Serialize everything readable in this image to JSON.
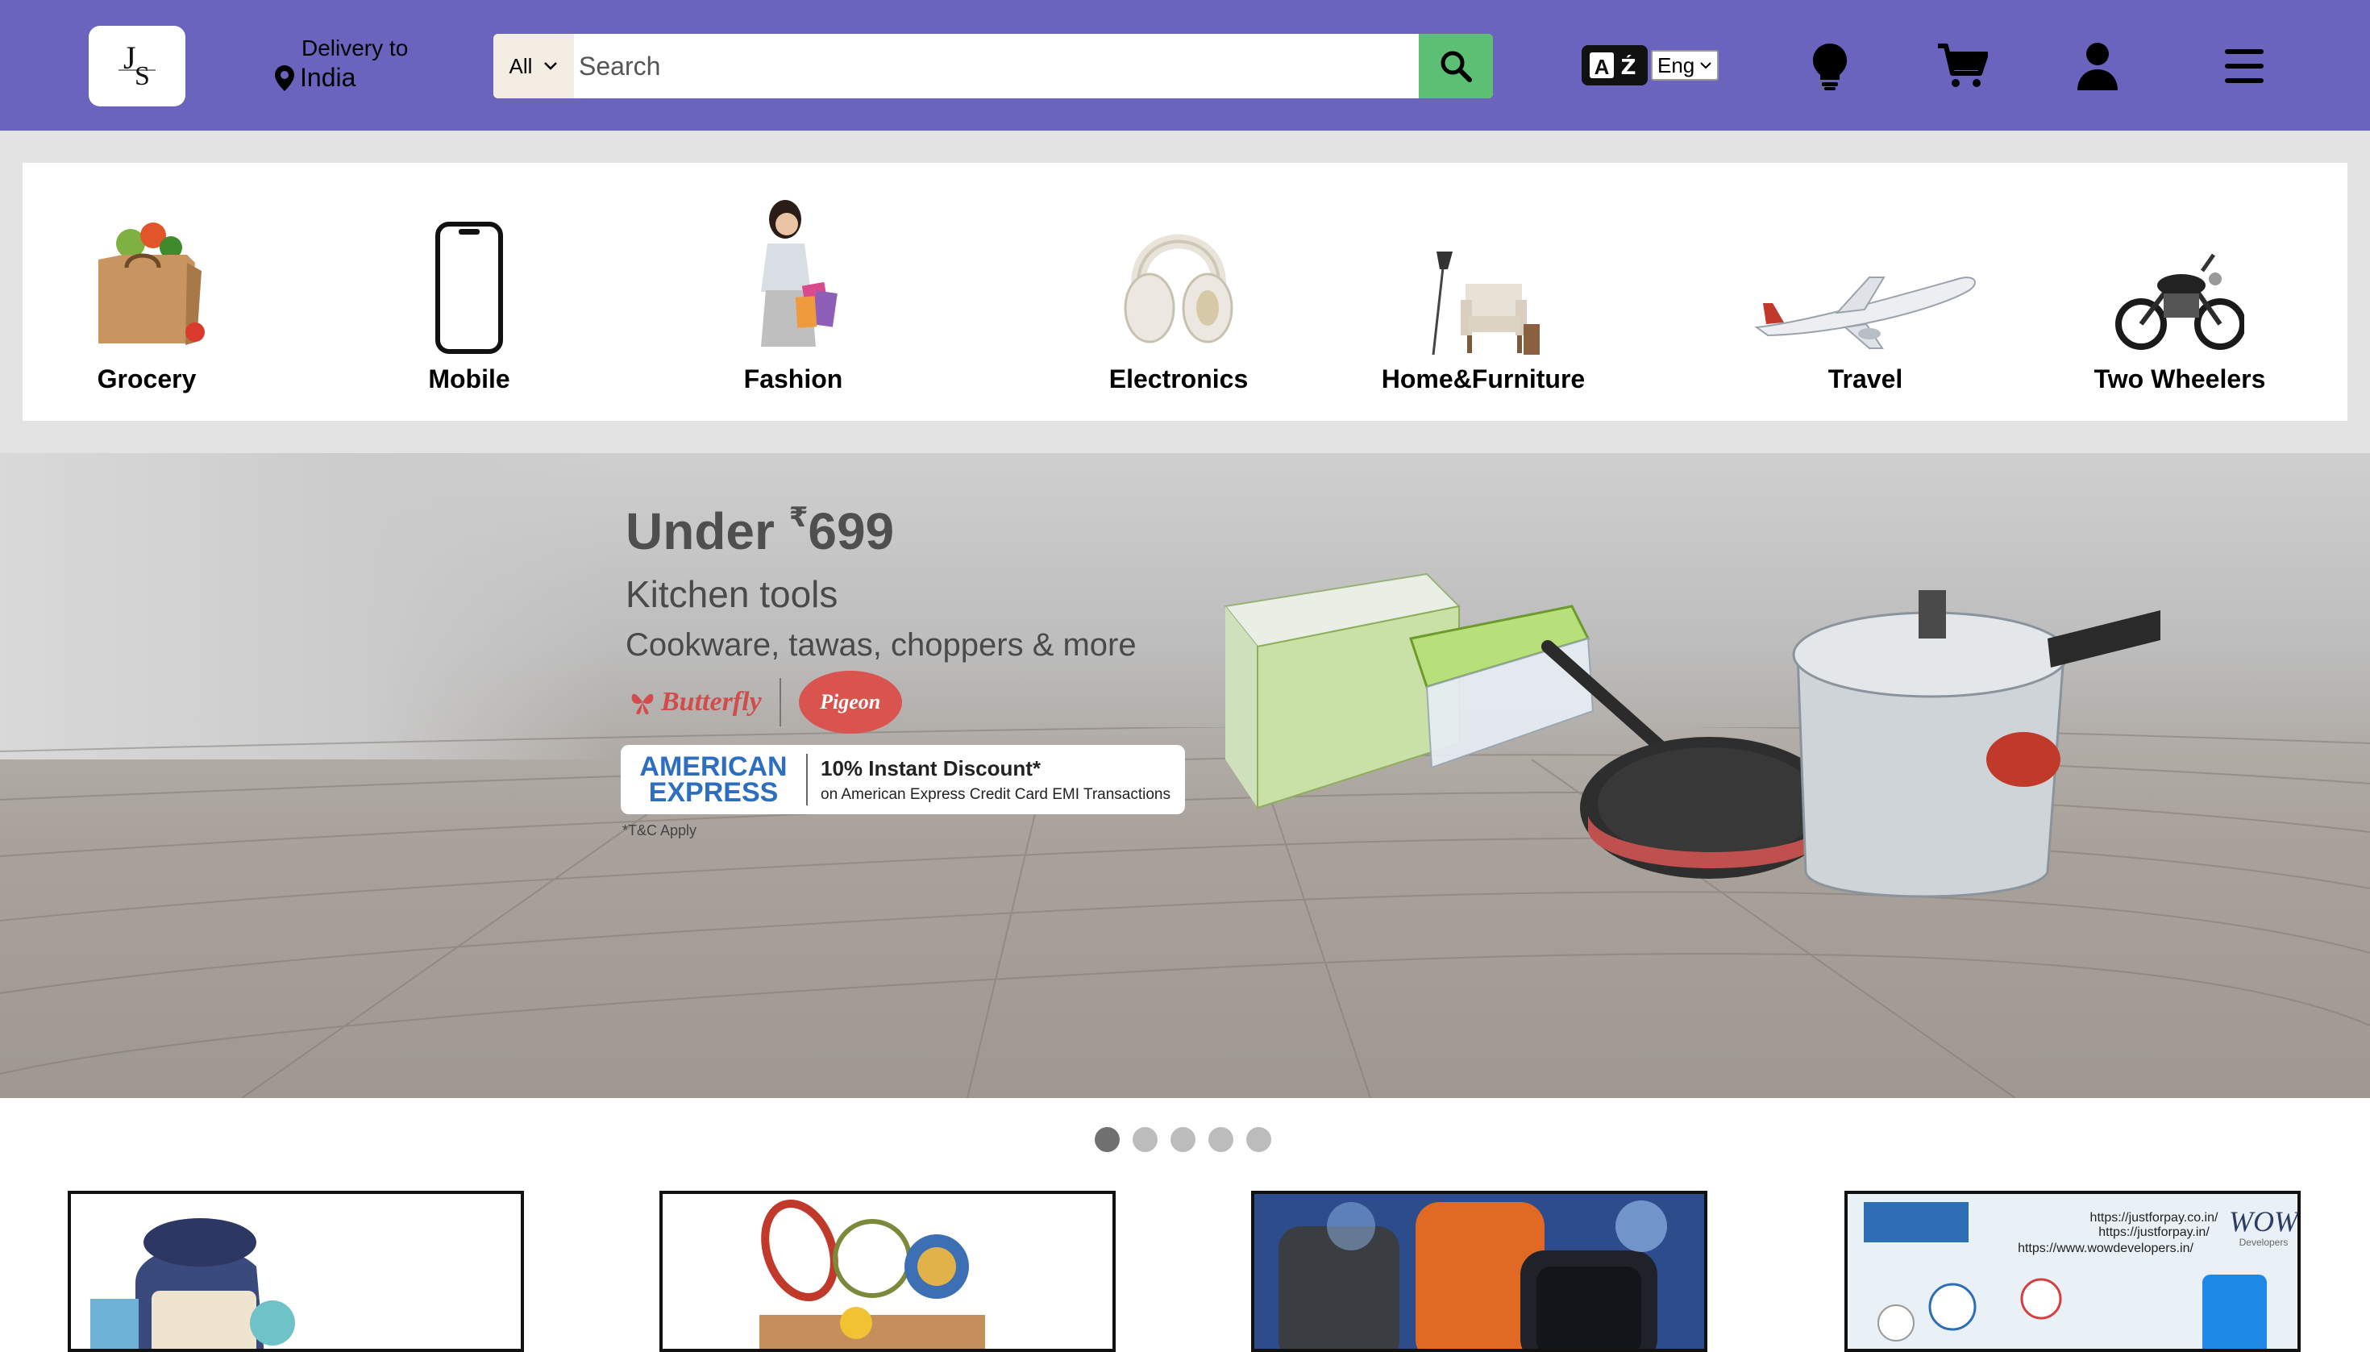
{
  "header": {
    "logo_letters": "JS",
    "delivery_label": "Delivery to",
    "delivery_location": "India",
    "search_category": "All",
    "search_placeholder": "Search",
    "language": "Eng",
    "icons": [
      "translate-icon",
      "lightbulb-icon",
      "cart-icon",
      "user-icon",
      "menu-icon"
    ],
    "colors": {
      "bar": "#6a64be",
      "search_button": "#5cbf74"
    }
  },
  "categories": [
    {
      "label": "Grocery",
      "icon": "grocery-bag-image"
    },
    {
      "label": "Mobile",
      "icon": "mobile-phone-image"
    },
    {
      "label": "Fashion",
      "icon": "fashion-shopper-image"
    },
    {
      "label": "Electronics",
      "icon": "headphones-image"
    },
    {
      "label": "Home&Furniture",
      "icon": "armchair-lamp-image"
    },
    {
      "label": "Travel",
      "icon": "airplane-image"
    },
    {
      "label": "Two Wheelers",
      "icon": "motorcycle-image"
    }
  ],
  "banner": {
    "headline_prefix": "Under ",
    "currency": "₹",
    "price": "699",
    "title": "Kitchen tools",
    "subtitle": "Cookware, tawas, choppers & more",
    "brand1": "Butterfly",
    "brand2": "Pigeon",
    "card_logo_line1": "AMERICAN",
    "card_logo_line2": "EXPRESS",
    "offer_title": "10% Instant Discount*",
    "offer_desc": "on American Express Credit Card EMI Transactions",
    "tc": "*T&C Apply"
  },
  "carousel": {
    "slides": 5,
    "active": 1
  },
  "product_cards": [
    {
      "name": "backpack-school-supplies-image"
    },
    {
      "name": "sports-equipment-box-image"
    },
    {
      "name": "smartwatches-image"
    },
    {
      "name": "justforpay-wow-developers-image",
      "urls": [
        "https://justforpay.co.in/",
        "https://justforpay.in/",
        "https://www.wowdevelopers.in/"
      ],
      "brand": "WOW",
      "sub": "Developers"
    }
  ]
}
